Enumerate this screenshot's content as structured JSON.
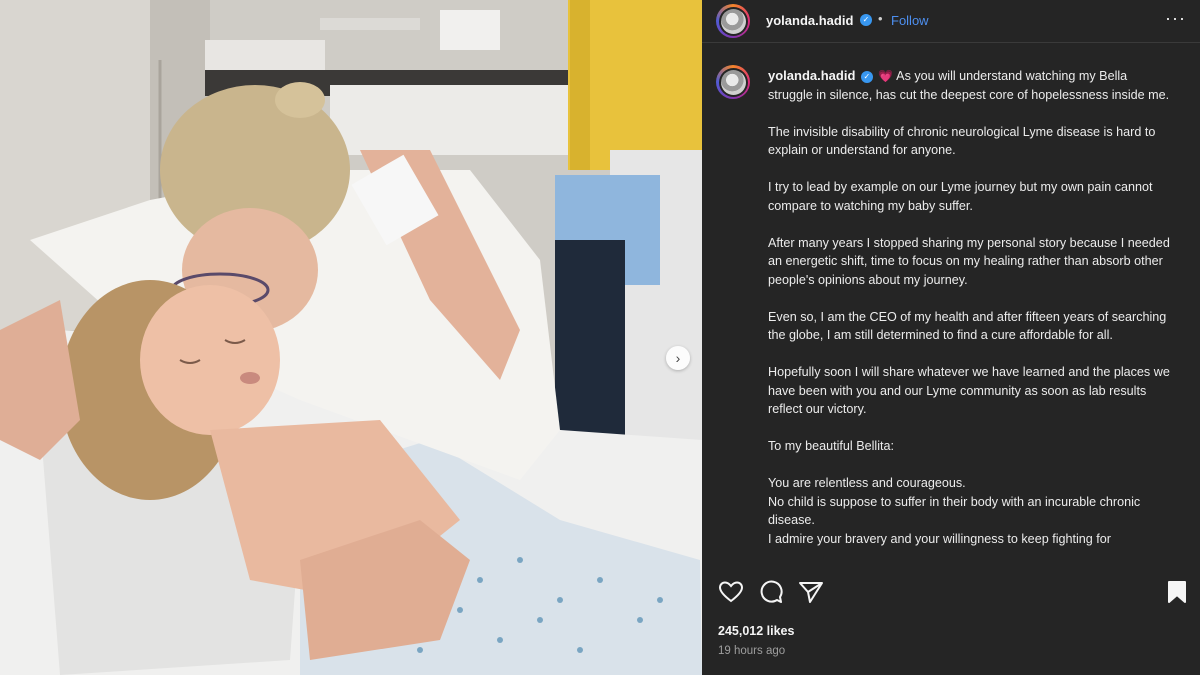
{
  "post": {
    "username": "yolanda.hadid",
    "follow_label": "Follow",
    "more_label": "···",
    "separator": "•"
  },
  "caption": {
    "username": "yolanda.hadid",
    "heart": "💗",
    "paragraphs": [
      "As you will understand watching my Bella struggle in silence, has cut the deepest core of hopelessness inside me.",
      "The invisible disability of chronic neurological Lyme disease is hard to explain or understand for anyone.",
      "I try to lead by example on our Lyme journey but my own pain cannot compare to watching my baby suffer.",
      "After many years I stopped sharing my personal story because I needed an energetic shift, time to focus on my healing rather than absorb other people's opinions about my journey.",
      "Even so, I am the CEO of my health and after fifteen years of searching the globe, I am still determined to find a cure affordable for all.",
      "Hopefully soon I will share whatever we have learned and the places we have been with you and our Lyme community as soon as lab results reflect our victory.",
      "To my beautiful Bellita:",
      "You are relentless and courageous.\nNo child is suppose to suffer in their body with an incurable chronic disease.\nI admire your bravery and your willingness to keep fighting for"
    ]
  },
  "engagement": {
    "likes": "245,012 likes",
    "time_ago": "19 hours ago"
  },
  "icons": {
    "like": "heart-outline-icon",
    "comment": "comment-bubble-icon",
    "share": "paper-plane-icon",
    "save": "bookmark-icon",
    "verified": "verified-badge-icon",
    "next": "chevron-right-icon"
  },
  "colors": {
    "panel_bg": "#252525",
    "follow_blue": "#4d8ff0",
    "verified_blue": "#3897f0",
    "heart_pink": "#ff5fa2"
  }
}
